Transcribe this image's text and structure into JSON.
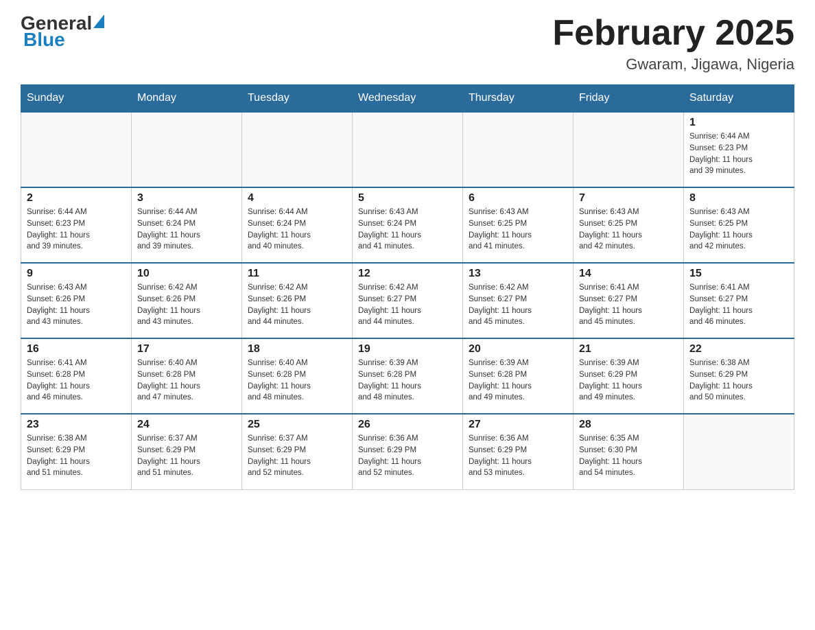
{
  "header": {
    "logo_general": "General",
    "logo_blue": "Blue",
    "month_title": "February 2025",
    "location": "Gwaram, Jigawa, Nigeria"
  },
  "weekdays": [
    "Sunday",
    "Monday",
    "Tuesday",
    "Wednesday",
    "Thursday",
    "Friday",
    "Saturday"
  ],
  "weeks": [
    [
      {
        "day": "",
        "info": ""
      },
      {
        "day": "",
        "info": ""
      },
      {
        "day": "",
        "info": ""
      },
      {
        "day": "",
        "info": ""
      },
      {
        "day": "",
        "info": ""
      },
      {
        "day": "",
        "info": ""
      },
      {
        "day": "1",
        "info": "Sunrise: 6:44 AM\nSunset: 6:23 PM\nDaylight: 11 hours\nand 39 minutes."
      }
    ],
    [
      {
        "day": "2",
        "info": "Sunrise: 6:44 AM\nSunset: 6:23 PM\nDaylight: 11 hours\nand 39 minutes."
      },
      {
        "day": "3",
        "info": "Sunrise: 6:44 AM\nSunset: 6:24 PM\nDaylight: 11 hours\nand 39 minutes."
      },
      {
        "day": "4",
        "info": "Sunrise: 6:44 AM\nSunset: 6:24 PM\nDaylight: 11 hours\nand 40 minutes."
      },
      {
        "day": "5",
        "info": "Sunrise: 6:43 AM\nSunset: 6:24 PM\nDaylight: 11 hours\nand 41 minutes."
      },
      {
        "day": "6",
        "info": "Sunrise: 6:43 AM\nSunset: 6:25 PM\nDaylight: 11 hours\nand 41 minutes."
      },
      {
        "day": "7",
        "info": "Sunrise: 6:43 AM\nSunset: 6:25 PM\nDaylight: 11 hours\nand 42 minutes."
      },
      {
        "day": "8",
        "info": "Sunrise: 6:43 AM\nSunset: 6:25 PM\nDaylight: 11 hours\nand 42 minutes."
      }
    ],
    [
      {
        "day": "9",
        "info": "Sunrise: 6:43 AM\nSunset: 6:26 PM\nDaylight: 11 hours\nand 43 minutes."
      },
      {
        "day": "10",
        "info": "Sunrise: 6:42 AM\nSunset: 6:26 PM\nDaylight: 11 hours\nand 43 minutes."
      },
      {
        "day": "11",
        "info": "Sunrise: 6:42 AM\nSunset: 6:26 PM\nDaylight: 11 hours\nand 44 minutes."
      },
      {
        "day": "12",
        "info": "Sunrise: 6:42 AM\nSunset: 6:27 PM\nDaylight: 11 hours\nand 44 minutes."
      },
      {
        "day": "13",
        "info": "Sunrise: 6:42 AM\nSunset: 6:27 PM\nDaylight: 11 hours\nand 45 minutes."
      },
      {
        "day": "14",
        "info": "Sunrise: 6:41 AM\nSunset: 6:27 PM\nDaylight: 11 hours\nand 45 minutes."
      },
      {
        "day": "15",
        "info": "Sunrise: 6:41 AM\nSunset: 6:27 PM\nDaylight: 11 hours\nand 46 minutes."
      }
    ],
    [
      {
        "day": "16",
        "info": "Sunrise: 6:41 AM\nSunset: 6:28 PM\nDaylight: 11 hours\nand 46 minutes."
      },
      {
        "day": "17",
        "info": "Sunrise: 6:40 AM\nSunset: 6:28 PM\nDaylight: 11 hours\nand 47 minutes."
      },
      {
        "day": "18",
        "info": "Sunrise: 6:40 AM\nSunset: 6:28 PM\nDaylight: 11 hours\nand 48 minutes."
      },
      {
        "day": "19",
        "info": "Sunrise: 6:39 AM\nSunset: 6:28 PM\nDaylight: 11 hours\nand 48 minutes."
      },
      {
        "day": "20",
        "info": "Sunrise: 6:39 AM\nSunset: 6:28 PM\nDaylight: 11 hours\nand 49 minutes."
      },
      {
        "day": "21",
        "info": "Sunrise: 6:39 AM\nSunset: 6:29 PM\nDaylight: 11 hours\nand 49 minutes."
      },
      {
        "day": "22",
        "info": "Sunrise: 6:38 AM\nSunset: 6:29 PM\nDaylight: 11 hours\nand 50 minutes."
      }
    ],
    [
      {
        "day": "23",
        "info": "Sunrise: 6:38 AM\nSunset: 6:29 PM\nDaylight: 11 hours\nand 51 minutes."
      },
      {
        "day": "24",
        "info": "Sunrise: 6:37 AM\nSunset: 6:29 PM\nDaylight: 11 hours\nand 51 minutes."
      },
      {
        "day": "25",
        "info": "Sunrise: 6:37 AM\nSunset: 6:29 PM\nDaylight: 11 hours\nand 52 minutes."
      },
      {
        "day": "26",
        "info": "Sunrise: 6:36 AM\nSunset: 6:29 PM\nDaylight: 11 hours\nand 52 minutes."
      },
      {
        "day": "27",
        "info": "Sunrise: 6:36 AM\nSunset: 6:29 PM\nDaylight: 11 hours\nand 53 minutes."
      },
      {
        "day": "28",
        "info": "Sunrise: 6:35 AM\nSunset: 6:30 PM\nDaylight: 11 hours\nand 54 minutes."
      },
      {
        "day": "",
        "info": ""
      }
    ]
  ]
}
